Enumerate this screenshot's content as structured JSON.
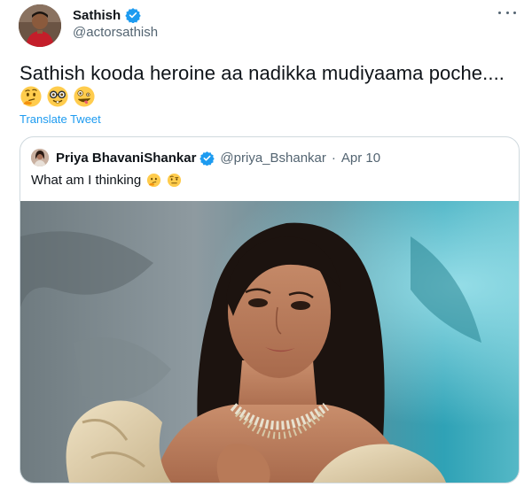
{
  "author": {
    "display_name": "Sathish",
    "handle": "@actorsathish",
    "verified": true
  },
  "tweet": {
    "text": "Sathish kooda heroine aa nadikka mudiyaama poche....",
    "emojis": [
      "thinking-face",
      "nerd-face",
      "zany-face"
    ],
    "translate_label": "Translate Tweet"
  },
  "quoted_tweet": {
    "display_name": "Priya BhavaniShankar",
    "handle": "@priya_Bshankar",
    "separator": "·",
    "date": "Apr 10",
    "verified": true,
    "text": "What am I thinking",
    "emojis": [
      "thinking-face",
      "face-with-raised-eyebrow"
    ],
    "image_alt": "Photo of a woman in gold saree with choker necklace"
  },
  "colors": {
    "link": "#1d9bf0",
    "secondary_text": "#536471",
    "border": "#cfd9de",
    "verified_badge": "#1d9bf0"
  }
}
